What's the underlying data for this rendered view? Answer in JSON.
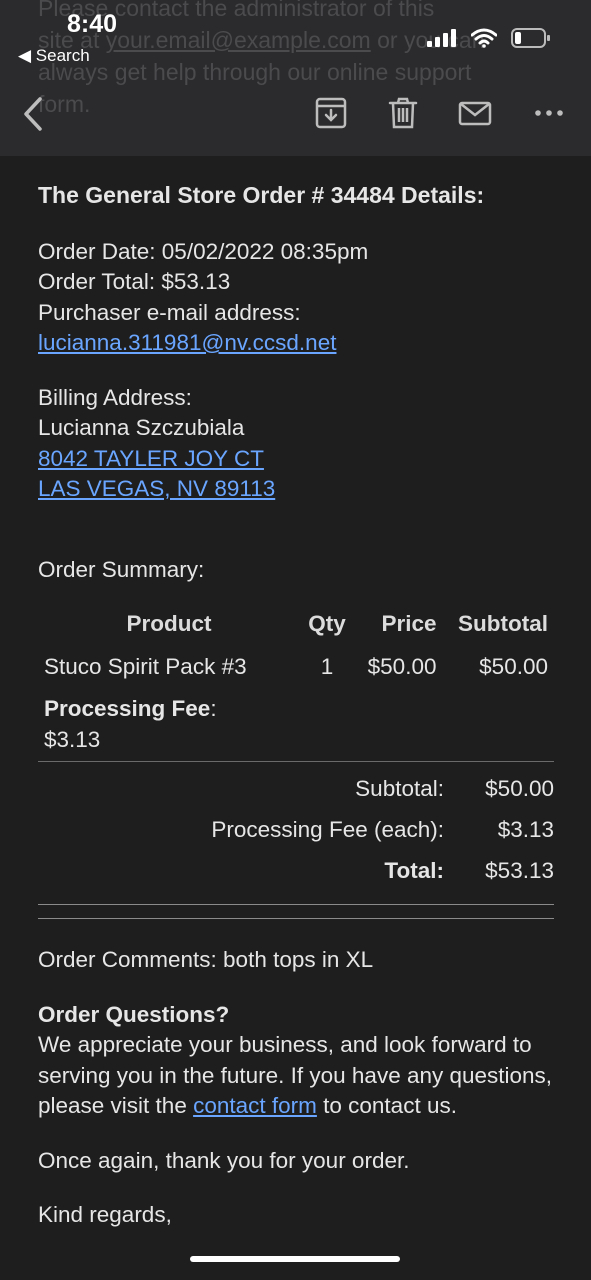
{
  "status_bar": {
    "time": "8:40",
    "back_label": "◀ Search"
  },
  "ghost_text": {
    "line1": "Please contact the administrator of this",
    "line2a": "site at",
    "line2b": "your.email@example.com",
    "line2c": "or you can",
    "line3": "always get help through our online support",
    "line4": "form."
  },
  "toolbar": {
    "icons": [
      "chevron-left-icon",
      "archive-icon",
      "trash-icon",
      "mail-icon",
      "more-icon"
    ]
  },
  "order": {
    "heading": "The General Store Order # 34484  Details:",
    "date": "Order Date: 05/02/2022 08:35pm",
    "total": "Order Total: $53.13",
    "email_label": "Purchaser e-mail address:",
    "email": "lucianna.311981@nv.ccsd.net",
    "billing_label": "Billing Address:",
    "name": "Lucianna Szczubiala",
    "address1": "8042 TAYLER JOY CT",
    "address2": "LAS VEGAS, NV 89113",
    "summary_label": "Order Summary:"
  },
  "table": {
    "headers": [
      "Product",
      "Qty",
      "Price",
      "Subtotal"
    ],
    "rows": [
      {
        "product": "Stuco Spirit Pack #3",
        "qty": "1",
        "price": "$50.00",
        "subtotal": "$50.00"
      }
    ],
    "fee_label": "Processing Fee",
    "fee_colon": ":",
    "fee_value": "$3.13"
  },
  "totals": {
    "subtotal_label": "Subtotal:",
    "subtotal_value": "$50.00",
    "fee_label": "Processing Fee (each):",
    "fee_value": "$3.13",
    "total_label": "Total:",
    "total_value": "$53.13"
  },
  "footer": {
    "comments": "Order Comments: both tops in XL",
    "questions_title": "Order Questions?",
    "questions_text_a": "We appreciate your business, and look forward to serving you in the future. If you have any questions, please visit the ",
    "contact_link": "contact form",
    "questions_text_b": " to contact us.",
    "thanks": "Once again, thank you for your order.",
    "regards": "Kind regards,"
  }
}
